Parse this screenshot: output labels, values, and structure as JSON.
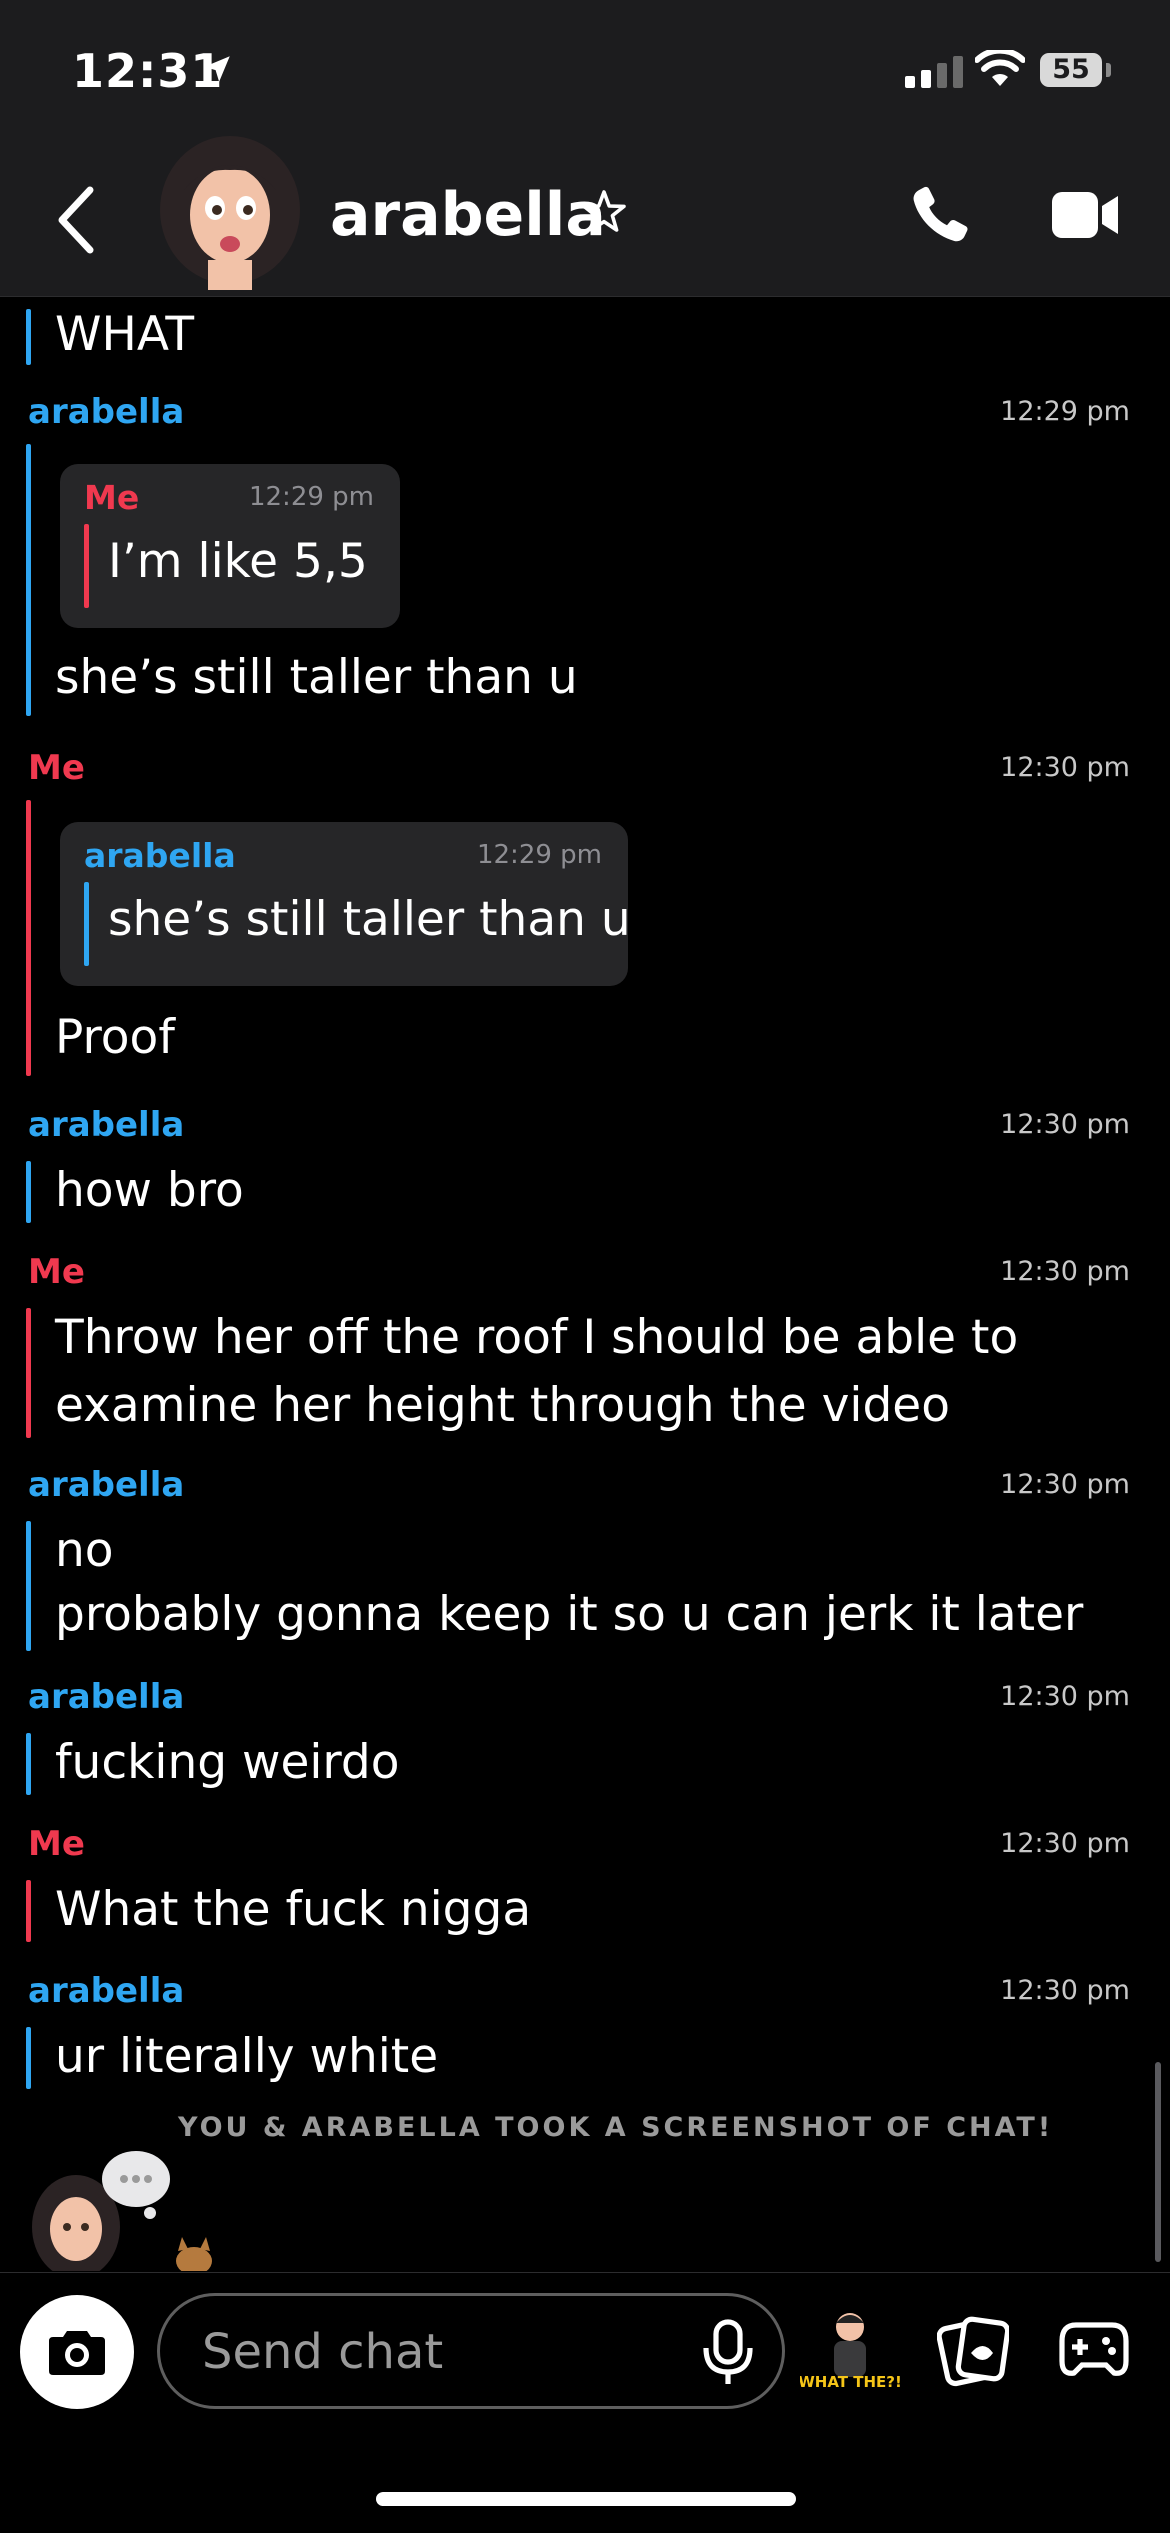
{
  "status_bar": {
    "time": "12:31",
    "battery": "55"
  },
  "header": {
    "contact_name": "arabella"
  },
  "messages": [
    {
      "text": "WHAT"
    },
    {
      "sender": "arabella",
      "time": "12:29 pm",
      "quote": {
        "sender": "Me",
        "time": "12:29 pm",
        "text": "I’m like 5,5"
      },
      "text": "she’s still taller than u"
    },
    {
      "sender": "Me",
      "time": "12:30 pm",
      "quote": {
        "sender": "arabella",
        "time": "12:29 pm",
        "text": "she’s still taller than u"
      },
      "text": "Proof"
    },
    {
      "sender": "arabella",
      "time": "12:30 pm",
      "text": "how bro"
    },
    {
      "sender": "Me",
      "time": "12:30 pm",
      "lines": [
        "Throw her off the roof I should be able to",
        "examine her height through the video"
      ]
    },
    {
      "sender": "arabella",
      "time": "12:30 pm",
      "lines": [
        "no",
        "probably gonna keep it so u can jerk it later"
      ]
    },
    {
      "sender": "arabella",
      "time": "12:30 pm",
      "text": "fucking weirdo"
    },
    {
      "sender": "Me",
      "time": "12:30 pm",
      "text": "What the fuck nigga"
    },
    {
      "sender": "arabella",
      "time": "12:30 pm",
      "text": "ur literally white"
    }
  ],
  "notice": "YOU & ARABELLA TOOK A SCREENSHOT OF CHAT!",
  "composer": {
    "placeholder": "Send chat"
  },
  "sticker_text": "WHAT THE?!",
  "colors": {
    "her": "#2fa6f2",
    "me": "#f0394f",
    "background": "#000000",
    "header": "#1c1c1e"
  },
  "icons": [
    "location-arrow-icon",
    "signal-icon",
    "wifi-icon",
    "battery-icon",
    "back-chevron-icon",
    "star-icon",
    "phone-icon",
    "video-camera-icon",
    "camera-icon",
    "microphone-icon",
    "memories-icon",
    "games-controller-icon"
  ]
}
